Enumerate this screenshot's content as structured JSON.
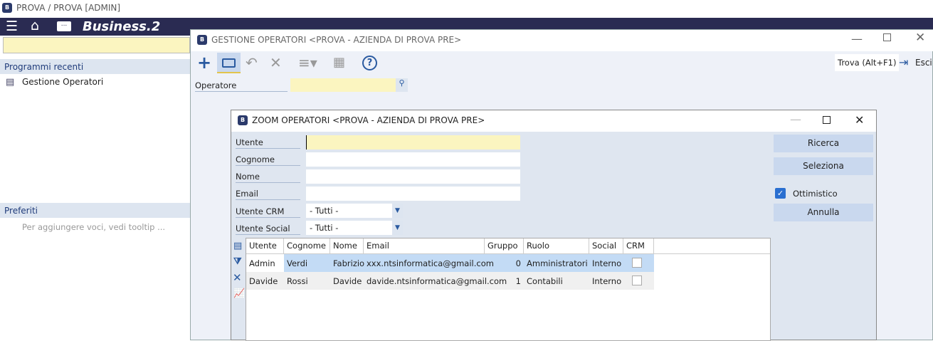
{
  "app": {
    "title": "PROVA / PROVA [ADMIN]",
    "brand": "Business.2"
  },
  "left": {
    "recent_header": "Programmi recenti",
    "recent_items": [
      "Gestione Operatori"
    ],
    "favorites_header": "Preferiti",
    "favorites_placeholder": "Per aggiungere voci, vedi tooltip ..."
  },
  "main": {
    "title": "GESTIONE OPERATORI <PROVA - AZIENDA DI PROVA PRE>",
    "find_label": "Trova (Alt+F1)",
    "exit_label": "Esci",
    "operator_label": "Operatore",
    "operator_value": ""
  },
  "zoom": {
    "title": "ZOOM OPERATORI <PROVA - AZIENDA DI PROVA PRE>",
    "fields": [
      {
        "label": "Utente",
        "value": ""
      },
      {
        "label": "Cognome",
        "value": ""
      },
      {
        "label": "Nome",
        "value": ""
      },
      {
        "label": "Email",
        "value": ""
      }
    ],
    "selects": [
      {
        "label": "Utente CRM",
        "value": "- Tutti -"
      },
      {
        "label": "Utente Social",
        "value": "- Tutti -"
      }
    ],
    "buttons": {
      "search": "Ricerca",
      "select": "Seleziona",
      "optimistic": "Ottimistico",
      "cancel": "Annulla"
    },
    "optimistic_checked": true,
    "columns": [
      "Utente",
      "Cognome",
      "Nome",
      "Email",
      "Gruppo",
      "Ruolo",
      "Social",
      "CRM"
    ],
    "rows": [
      [
        "Admin",
        "Verdi",
        "Fabrizio",
        "xxx.ntsinformatica@gmail.com",
        "0",
        "Amministratori",
        "Interno",
        false
      ],
      [
        "Davide",
        "Rossi",
        "Davide",
        "davide.ntsinformatica@gmail.com",
        "1",
        "Contabili",
        "Interno",
        false
      ]
    ]
  }
}
